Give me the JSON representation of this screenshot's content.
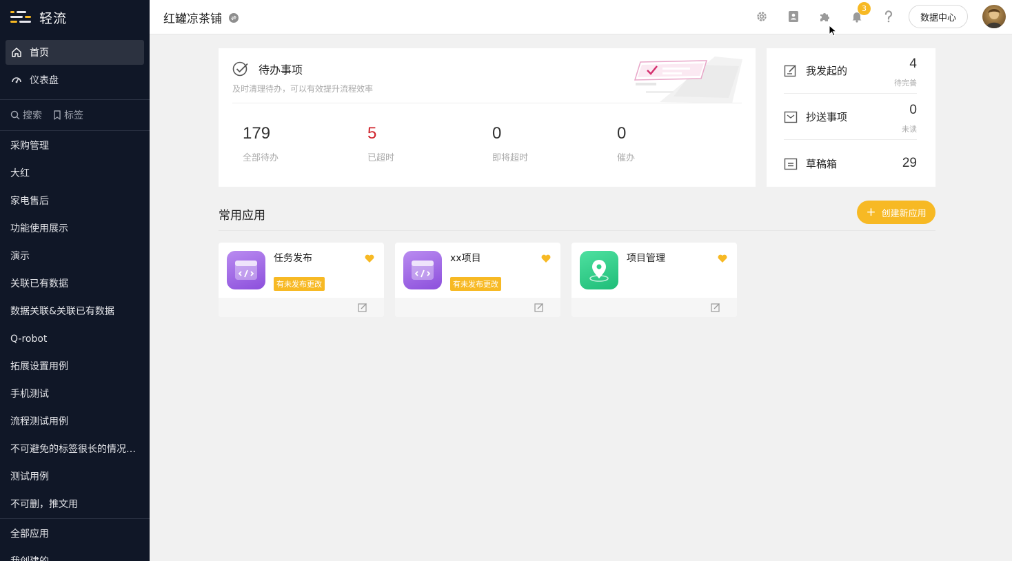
{
  "brand": {
    "name": "轻流",
    "accent": "#f7b924",
    "sidebar_bg": "#101727"
  },
  "sidebar": {
    "main": [
      {
        "label": "首页",
        "icon": "home-icon",
        "active": true
      },
      {
        "label": "仪表盘",
        "icon": "dashboard-icon",
        "active": false
      }
    ],
    "search_label": "搜索",
    "tags_label": "标签",
    "apps": [
      "采购管理",
      "大红",
      "家电售后",
      "功能使用展示",
      "演示",
      "关联已有数据",
      "数据关联&关联已有数据",
      "Q-robot",
      "拓展设置用例",
      "手机测试",
      "流程测试用例",
      "不可避免的标签很长的情况，...",
      "测试用例",
      "不可删，推文用"
    ],
    "footer": [
      "全部应用",
      "我创建的"
    ]
  },
  "topbar": {
    "workspace": "红罐凉茶铺",
    "notification_count": "3",
    "data_center": "数据中心"
  },
  "todo": {
    "title": "待办事项",
    "subtitle": "及时清理待办，可以有效提升流程效率",
    "stats": [
      {
        "value": "179",
        "label": "全部待办"
      },
      {
        "value": "5",
        "label": "已超时"
      },
      {
        "value": "0",
        "label": "即将超时"
      },
      {
        "value": "0",
        "label": "催办"
      }
    ]
  },
  "mine": [
    {
      "label": "我发起的",
      "value": "4",
      "sub": "待完善",
      "icon": "edit-doc-icon"
    },
    {
      "label": "抄送事项",
      "value": "0",
      "sub": "未读",
      "icon": "mail-icon"
    },
    {
      "label": "草稿箱",
      "value": "29",
      "sub": "",
      "icon": "draft-icon"
    }
  ],
  "apps_section": {
    "title": "常用应用",
    "create_label": "创建新应用",
    "cards": [
      {
        "name": "任务发布",
        "tag": "有未发布更改",
        "icon": "code-window-icon",
        "color": "#9a5fe3"
      },
      {
        "name": "xx项目",
        "tag": "有未发布更改",
        "icon": "code-window-icon",
        "color": "#9a5fe3"
      },
      {
        "name": "项目管理",
        "tag": "",
        "icon": "map-pin-icon",
        "color": "#2fcf88"
      }
    ]
  }
}
